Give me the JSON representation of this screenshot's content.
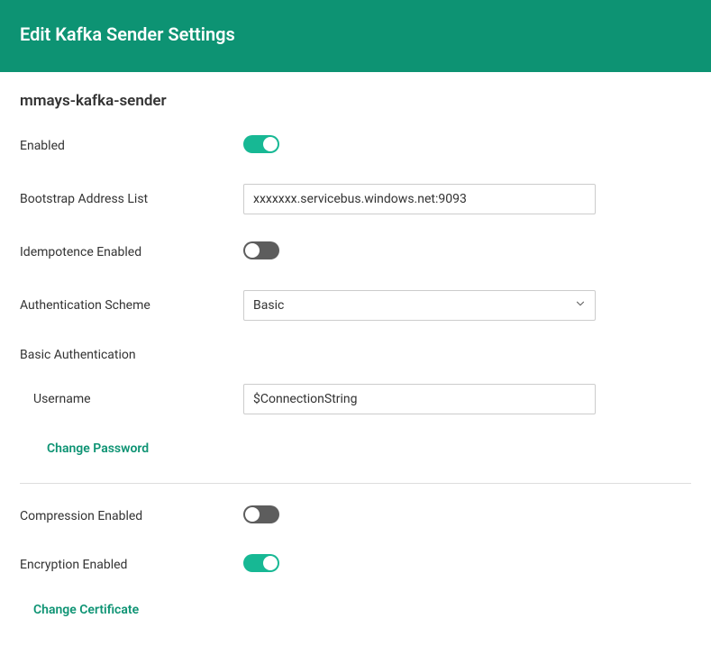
{
  "header": {
    "title": "Edit Kafka Sender Settings"
  },
  "page": {
    "title": "mmays-kafka-sender"
  },
  "fields": {
    "enabled": {
      "label": "Enabled",
      "value": true
    },
    "bootstrap": {
      "label": "Bootstrap Address List",
      "value": "xxxxxxx.servicebus.windows.net:9093"
    },
    "idempotence": {
      "label": "Idempotence Enabled",
      "value": false
    },
    "authScheme": {
      "label": "Authentication Scheme",
      "value": "Basic"
    },
    "basicAuth": {
      "sectionLabel": "Basic Authentication",
      "username": {
        "label": "Username",
        "value": "$ConnectionString"
      },
      "changePassword": "Change Password"
    },
    "compression": {
      "label": "Compression Enabled",
      "value": false
    },
    "encryption": {
      "label": "Encryption Enabled",
      "value": true
    },
    "changeCertificate": "Change Certificate"
  }
}
